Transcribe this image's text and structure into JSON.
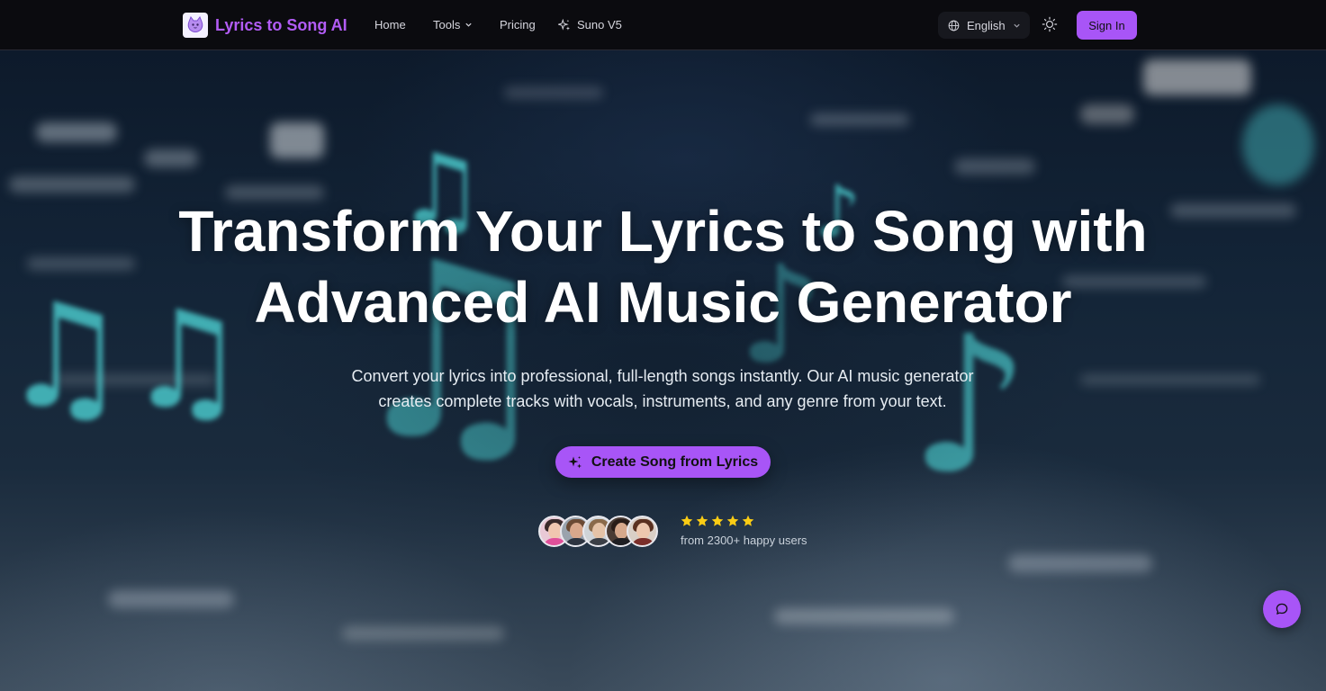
{
  "header": {
    "brand_name": "Lyrics to Song AI",
    "nav": {
      "home": "Home",
      "tools": "Tools",
      "pricing": "Pricing",
      "suno": "Suno V5"
    },
    "language": "English",
    "sign_in": "Sign In"
  },
  "hero": {
    "title_line1": "Transform Your Lyrics to Song with",
    "title_line2": "Advanced AI Music Generator",
    "subtitle_line1": "Convert your lyrics into professional, full-length songs instantly. Our AI music generator",
    "subtitle_line2": "creates complete tracks with vocals, instruments, and any genre from your text.",
    "cta_label": "Create Song from Lyrics",
    "rating_stars": 5,
    "rating_text": "from 2300+ happy users"
  },
  "colors": {
    "accent": "#a855f7",
    "brand_text": "#b25cf5",
    "header_bg": "#0b0b0f",
    "star": "#facc15",
    "note_teal": "#49c6c9"
  },
  "icons": {
    "logo": "cat-logo-icon",
    "tools_dropdown": "chevron-down-icon",
    "suno": "sparkles-icon",
    "language": "globe-icon",
    "theme": "sun-icon",
    "cta": "sparkles-icon",
    "chat": "chat-bubble-icon"
  }
}
